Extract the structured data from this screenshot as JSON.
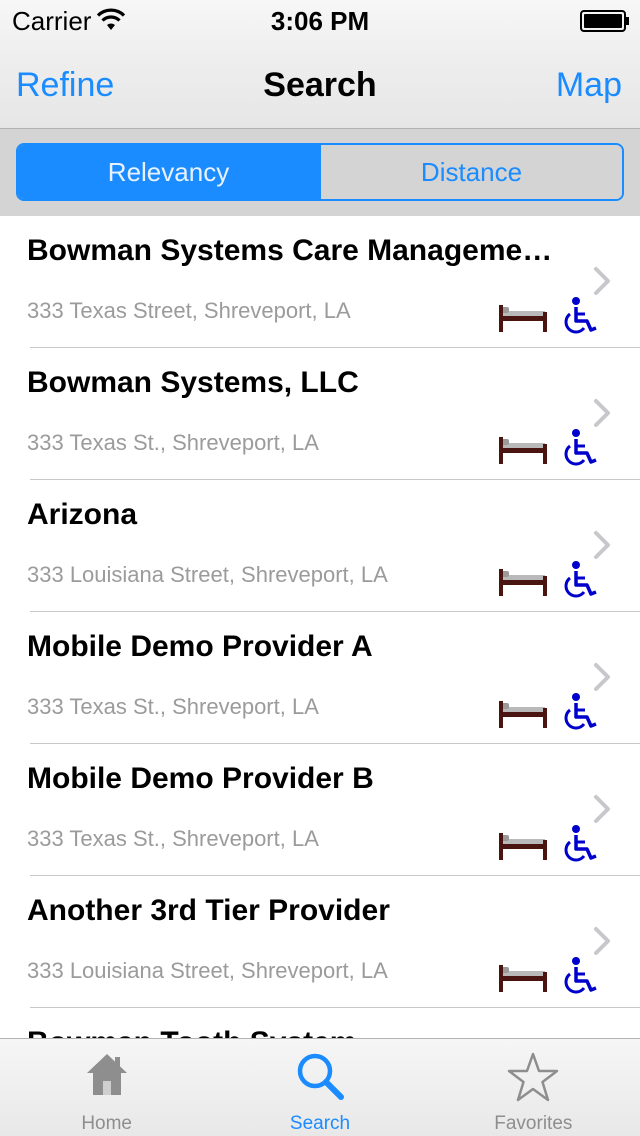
{
  "status": {
    "carrier": "Carrier",
    "time": "3:06 PM"
  },
  "nav": {
    "left_label": "Refine",
    "title": "Search",
    "right_label": "Map"
  },
  "segments": [
    {
      "label": "Relevancy",
      "selected": true
    },
    {
      "label": "Distance",
      "selected": false
    }
  ],
  "results": [
    {
      "title": "Bowman Systems Care Manageme…",
      "address": "333 Texas Street, Shreveport, LA"
    },
    {
      "title": "Bowman Systems, LLC",
      "address": "333 Texas St., Shreveport, LA"
    },
    {
      "title": "Arizona",
      "address": "333 Louisiana Street, Shreveport, LA"
    },
    {
      "title": "Mobile Demo Provider A",
      "address": "333 Texas St., Shreveport, LA"
    },
    {
      "title": "Mobile Demo Provider B",
      "address": "333 Texas St., Shreveport, LA"
    },
    {
      "title": "Another 3rd Tier Provider",
      "address": "333 Louisiana Street, Shreveport, LA"
    },
    {
      "title": "Bowman Tooth System",
      "address": ""
    }
  ],
  "tabs": [
    {
      "label": "Home",
      "icon": "home-icon",
      "selected": false
    },
    {
      "label": "Search",
      "icon": "search-icon",
      "selected": true
    },
    {
      "label": "Favorites",
      "icon": "star-icon",
      "selected": false
    }
  ],
  "colors": {
    "accent": "#1a8cff",
    "bed": "#4a1510",
    "wheelchair": "#0000cc"
  }
}
